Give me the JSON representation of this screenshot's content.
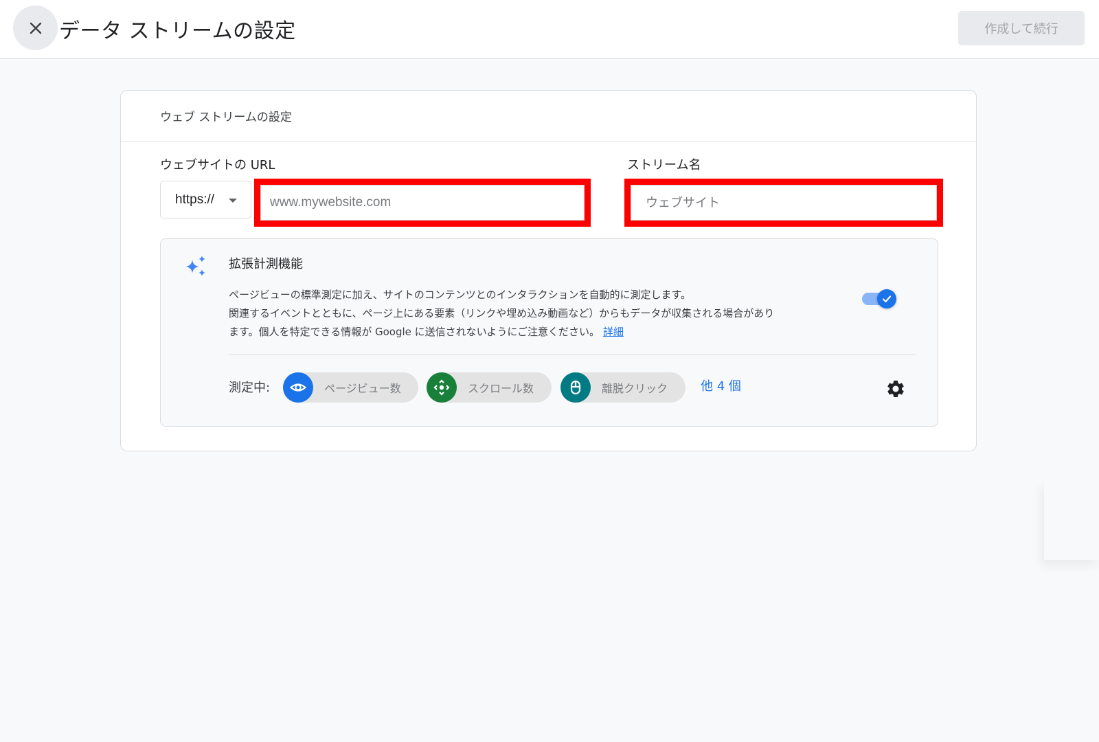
{
  "header": {
    "title": "データ ストリームの設定",
    "close_icon": "close-icon",
    "primary_button": "作成して続行"
  },
  "card": {
    "title": "ウェブ ストリームの設定",
    "url_field": {
      "label": "ウェブサイトの URL",
      "protocol": "https://",
      "value": "",
      "placeholder": "www.mywebsite.com"
    },
    "stream_name_field": {
      "label": "ストリーム名",
      "value": "",
      "placeholder": "ウェブサイト"
    },
    "enhanced_measurement": {
      "icon": "sparkle-icon",
      "title": "拡張計測機能",
      "description_line1": "ページビューの標準測定に加え、サイトのコンテンツとのインタラクションを自動的に測定します。",
      "description_line2": "関連するイベントとともに、ページ上にある要素（リンクや埋め込み動画など）からもデータが収集される場合があり",
      "description_line3": "ます。個人を特定できる情報が Google に送信されないようにご注意ください。",
      "learn_more": "詳細",
      "enabled": true,
      "measuring_label": "測定中:",
      "chips": [
        {
          "label": "ページビュー数",
          "icon": "eye-icon",
          "color": "#1a73e8"
        },
        {
          "label": "スクロール数",
          "icon": "scroll-arrows-icon",
          "color": "#188038"
        },
        {
          "label": "離脱クリック",
          "icon": "mouse-icon",
          "color": "#007b83"
        }
      ],
      "more": "他 4 個",
      "settings_icon": "gear-icon"
    }
  },
  "colors": {
    "accent": "#1a73e8",
    "highlight_outline": "#ff0000"
  }
}
